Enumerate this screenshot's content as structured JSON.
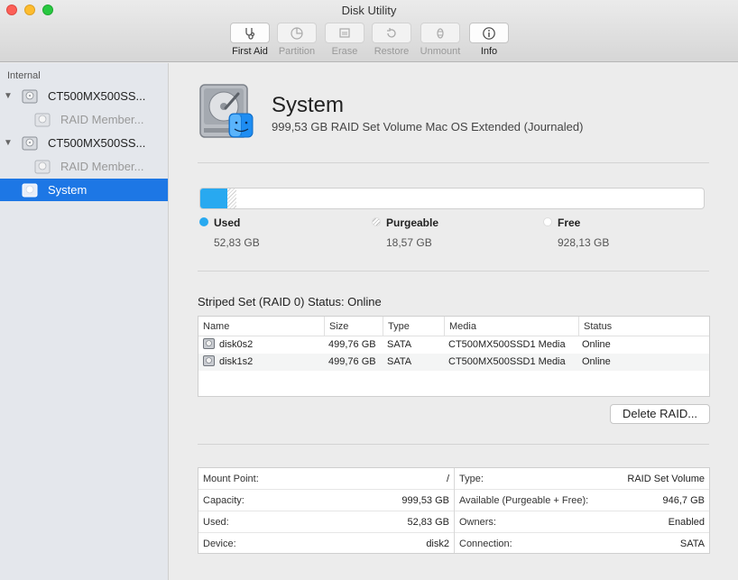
{
  "window": {
    "title": "Disk Utility"
  },
  "toolbar": {
    "items": [
      {
        "label": "First Aid",
        "icon": "stethoscope-icon",
        "enabled": true
      },
      {
        "label": "Partition",
        "icon": "pie-chart-icon",
        "enabled": false
      },
      {
        "label": "Erase",
        "icon": "eraser-icon",
        "enabled": false
      },
      {
        "label": "Restore",
        "icon": "restore-arrow-icon",
        "enabled": false
      },
      {
        "label": "Unmount",
        "icon": "eject-icon",
        "enabled": false
      },
      {
        "label": "Info",
        "icon": "info-icon",
        "enabled": true
      }
    ]
  },
  "sidebar": {
    "heading": "Internal",
    "items": [
      {
        "label": "CT500MX500SS...",
        "icon": "hard-disk-icon",
        "level": 0,
        "expanded": true
      },
      {
        "label": "RAID Member...",
        "icon": "hard-disk-icon",
        "level": 1
      },
      {
        "label": "CT500MX500SS...",
        "icon": "hard-disk-icon",
        "level": 0,
        "expanded": true
      },
      {
        "label": "RAID Member...",
        "icon": "hard-disk-icon",
        "level": 1
      },
      {
        "label": "System",
        "icon": "hard-disk-icon",
        "level": 0,
        "selected": true
      }
    ]
  },
  "volume": {
    "name": "System",
    "description": "999,53 GB RAID Set Volume Mac OS Extended (Journaled)"
  },
  "usage": {
    "used_fraction": 0.0529,
    "purgeable_fraction": 0.0186,
    "used": {
      "label": "Used",
      "value": "52,83 GB",
      "color": "#28a9f0"
    },
    "purgeable": {
      "label": "Purgeable",
      "value": "18,57 GB"
    },
    "free": {
      "label": "Free",
      "value": "928,13 GB"
    }
  },
  "raid": {
    "title": "Striped Set (RAID 0) Status: Online",
    "columns": [
      "Name",
      "Size",
      "Type",
      "Media",
      "Status"
    ],
    "rows": [
      {
        "name": "disk0s2",
        "size": "499,76 GB",
        "type": "SATA",
        "media": "CT500MX500SSD1 Media",
        "status": "Online"
      },
      {
        "name": "disk1s2",
        "size": "499,76 GB",
        "type": "SATA",
        "media": "CT500MX500SSD1 Media",
        "status": "Online"
      }
    ],
    "delete_label": "Delete RAID..."
  },
  "info": {
    "left": [
      {
        "key": "Mount Point:",
        "value": "/"
      },
      {
        "key": "Capacity:",
        "value": "999,53 GB"
      },
      {
        "key": "Used:",
        "value": "52,83 GB"
      },
      {
        "key": "Device:",
        "value": "disk2"
      }
    ],
    "right": [
      {
        "key": "Type:",
        "value": "RAID Set Volume"
      },
      {
        "key": "Available (Purgeable + Free):",
        "value": "946,7 GB"
      },
      {
        "key": "Owners:",
        "value": "Enabled"
      },
      {
        "key": "Connection:",
        "value": "SATA"
      }
    ]
  }
}
